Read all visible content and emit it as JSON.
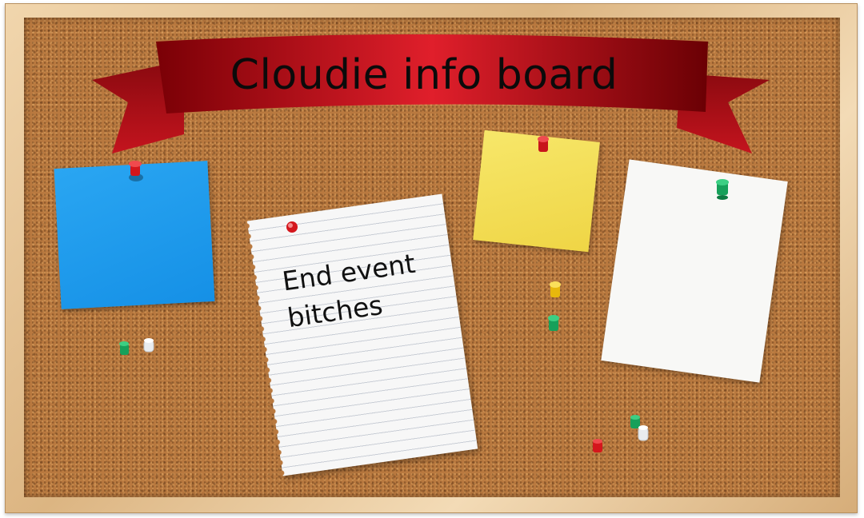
{
  "board": {
    "title": "Cloudie info board",
    "note_text_line1": "End event",
    "note_text_line2": "bitches"
  },
  "colors": {
    "banner": "#c8101c",
    "banner_dark": "#5a0003",
    "cork": "#b9793f",
    "frame": "#e6c59a",
    "note_blue": "#1f9cf0",
    "note_yellow": "#f3de55",
    "note_white": "#f8f8f6"
  },
  "icons": [
    "pushpin-red-icon",
    "pushpin-green-icon",
    "pushpin-yellow-icon",
    "pushpin-clear-icon"
  ]
}
